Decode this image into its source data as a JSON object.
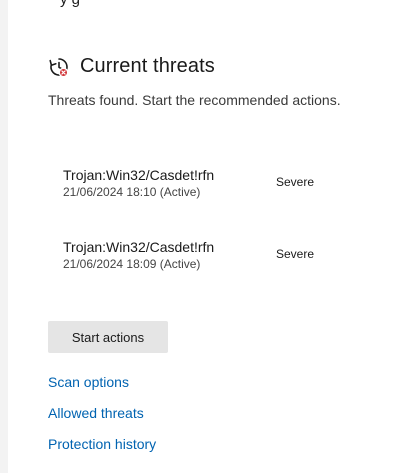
{
  "header_fragment": "y                g",
  "current_threats": {
    "title": "Current threats",
    "subtitle": "Threats found. Start the recommended actions.",
    "items": [
      {
        "name": "Trojan:Win32/Casdet!rfn",
        "date": "21/06/2024 18:10 (Active)",
        "severity": "Severe"
      },
      {
        "name": "Trojan:Win32/Casdet!rfn",
        "date": "21/06/2024 18:09 (Active)",
        "severity": "Severe"
      }
    ],
    "start_actions_label": "Start actions"
  },
  "links": {
    "scan_options": "Scan options",
    "allowed_threats": "Allowed threats",
    "protection_history": "Protection history"
  },
  "colors": {
    "link": "#0063b1",
    "button_bg": "#e5e5e5",
    "alert_dot": "#d13438"
  },
  "icons": {
    "threat_icon": "clock-history-alert-icon"
  }
}
